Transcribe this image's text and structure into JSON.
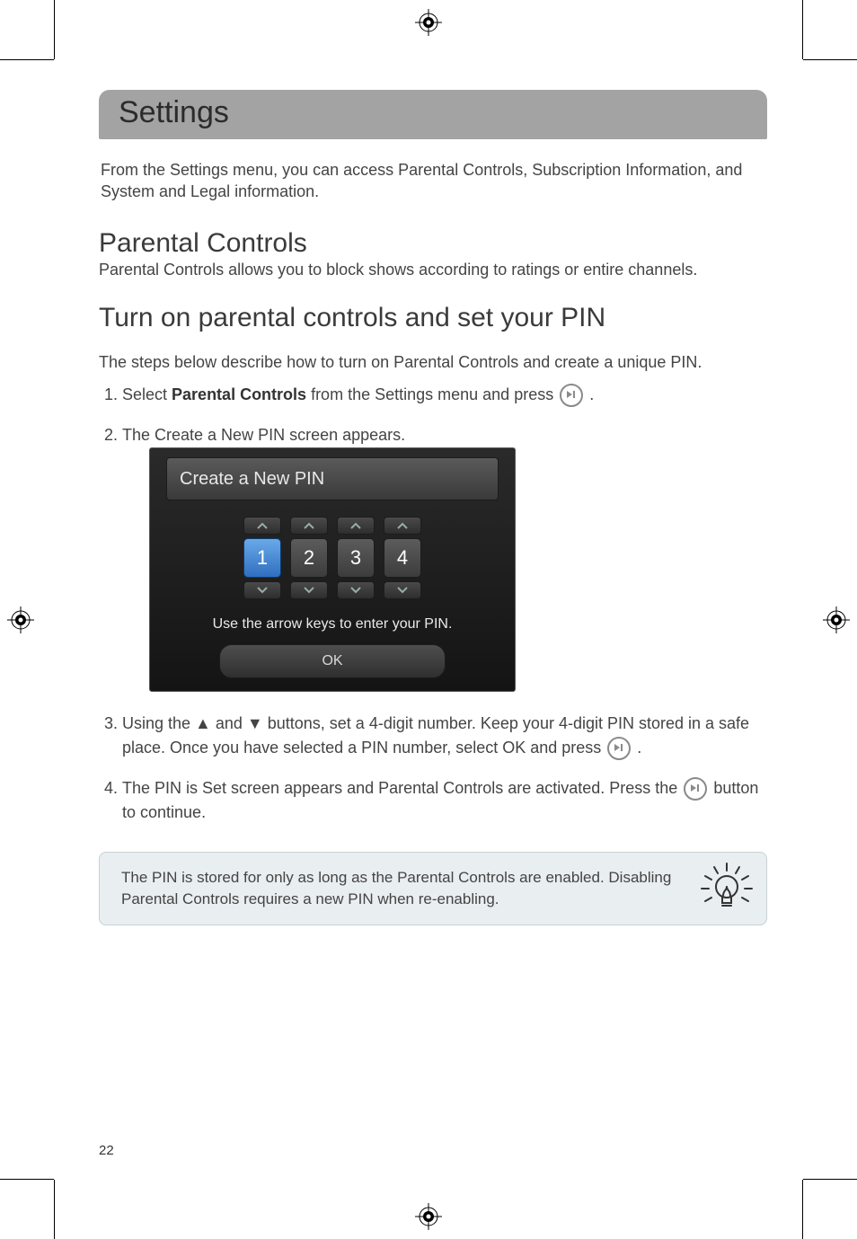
{
  "banner": {
    "title": "Settings"
  },
  "intro": "From the Settings menu, you can access Parental Controls, Subscription Information, and System and Legal information.",
  "section1": {
    "heading": "Parental Controls",
    "sub": "Parental Controls allows you to block shows according to ratings or entire channels."
  },
  "section2": {
    "heading": "Turn on parental controls and set your PIN",
    "lead": "The steps below describe how to turn on Parental Controls and create a unique PIN."
  },
  "steps": {
    "s1_a": "Select ",
    "s1_bold": "Parental Controls",
    "s1_b": " from the Settings menu and press ",
    "s1_c": " .",
    "s2": "The Create a New PIN screen appears.",
    "s3_a": "Using the ",
    "s3_up": "▲",
    "s3_mid": " and ",
    "s3_down": "▼",
    "s3_b": " buttons, set a 4-digit number. Keep your 4-digit PIN stored in a safe place. Once you have selected a PIN number, select OK and press ",
    "s3_c": " .",
    "s4_a": "The PIN is Set screen appears and Parental Controls are activated. Press the ",
    "s4_b": " button to continue."
  },
  "screenshot": {
    "title": "Create a New PIN",
    "digits": [
      "1",
      "2",
      "3",
      "4"
    ],
    "hint": "Use the arrow keys to enter your PIN.",
    "ok": "OK"
  },
  "tip": "The PIN is stored for only as long as the Parental Controls are enabled. Disabling Parental Controls requires a new PIN when re-enabling.",
  "page_number": "22"
}
